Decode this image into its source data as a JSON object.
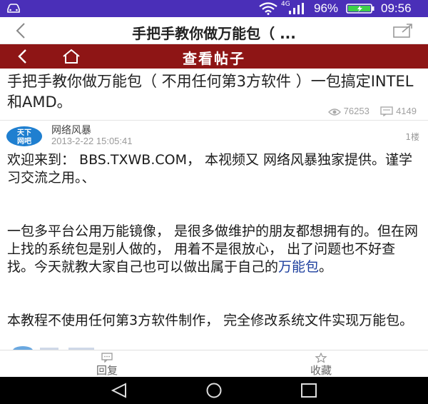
{
  "status_bar": {
    "network_type": "4G",
    "battery_percent": "96%",
    "time": "09:56",
    "background_color": "#4a2fb8",
    "icons": [
      "car-icon",
      "wifi-icon",
      "signal-icon",
      "battery-icon"
    ]
  },
  "app_bar": {
    "title": "手把手教你做万能包（ ...",
    "icons": [
      "back-icon",
      "share-icon"
    ]
  },
  "web_header": {
    "title": "查看帖子",
    "background_color": "#8e1515",
    "icons": [
      "back-icon",
      "home-icon"
    ]
  },
  "post": {
    "title": "手把手教你做万能包（ 不用任何第3方软件 ）一包搞定INTEL和AMD。",
    "views": "76253",
    "replies": "4149",
    "author": "网络风暴",
    "avatar_text_line1": "天下",
    "avatar_text_line2": "网吧",
    "time": "2013-2-22 15:05:41",
    "floor": "1楼",
    "paragraph1": "欢迎来到： BBS.TXWB.COM， 本视频又 网络风暴独家提供。谨学习交流之用。、",
    "paragraph2_text": "一包多平台公用万能镜像， 是很多做维护的朋友都想拥有的。但在网上找的系统包是别人做的， 用着不是很放心， 出了问题也不好查找。今天就教大家自己也可以做出属于自己的",
    "paragraph2_link": "万能包",
    "paragraph2_end": "。",
    "paragraph3": "本教程不使用任何第3方软件制作， 完全修改系统文件实现万能包。",
    "link_color": "#1d3f9e"
  },
  "actions": {
    "reply_label": "回复",
    "favorite_label": "收藏"
  },
  "nav_bar": {
    "icons": [
      "nav-back-icon",
      "nav-home-icon",
      "nav-recent-icon"
    ]
  }
}
